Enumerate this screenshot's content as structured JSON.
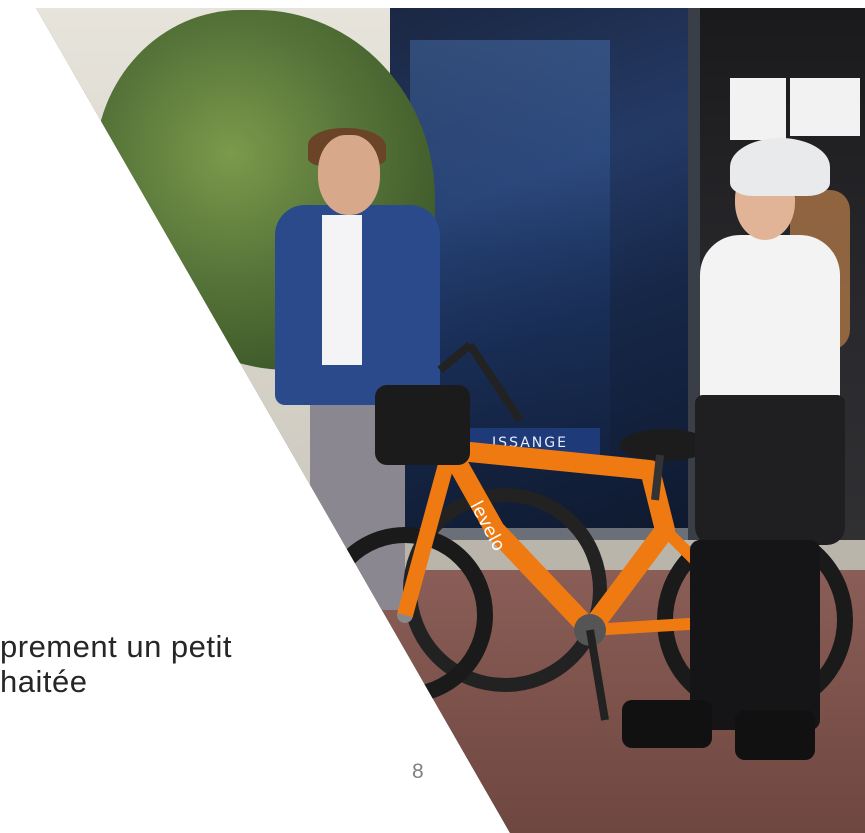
{
  "slide": {
    "caption_lines": [
      "prement un petit",
      "haitée"
    ],
    "page_number": "8"
  },
  "photo": {
    "storefront_sign": "ISSANGE",
    "bike_brand": "levelo"
  },
  "colors": {
    "bike_orange": "#f07a12",
    "jacket_blue": "#2b4a8c",
    "slide_background": "#ffffff",
    "caption_text": "#262626",
    "page_number_text": "#808080"
  }
}
